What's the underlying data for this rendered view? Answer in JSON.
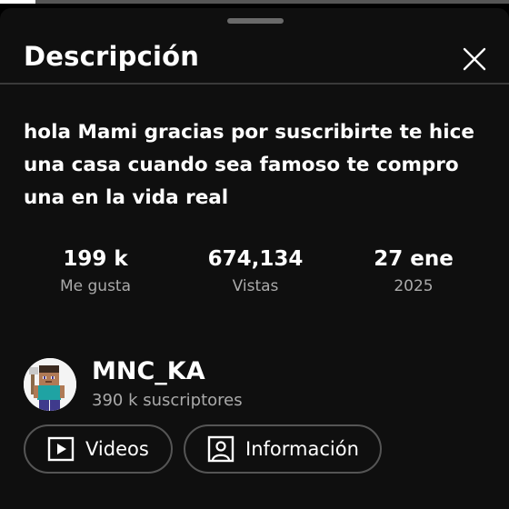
{
  "playback": {
    "progress_percent": 7
  },
  "sheet": {
    "title": "Descripción"
  },
  "icons": {
    "close": "close-icon",
    "video": "video-play-icon",
    "info": "person-box-icon"
  },
  "description": "hola Mami gracias por suscribirte  te hice\nuna casa cuando sea famoso te compro\nuna en la vida real",
  "stats": {
    "likes": {
      "value": "199 k",
      "label": "Me gusta"
    },
    "views": {
      "value": "674,134",
      "label": "Vistas"
    },
    "date": {
      "value": "27 ene",
      "label": "2025"
    }
  },
  "channel": {
    "name": "MNC_KA",
    "subscribers": "390 k suscriptores"
  },
  "buttons": {
    "videos": "Videos",
    "info": "Información"
  }
}
